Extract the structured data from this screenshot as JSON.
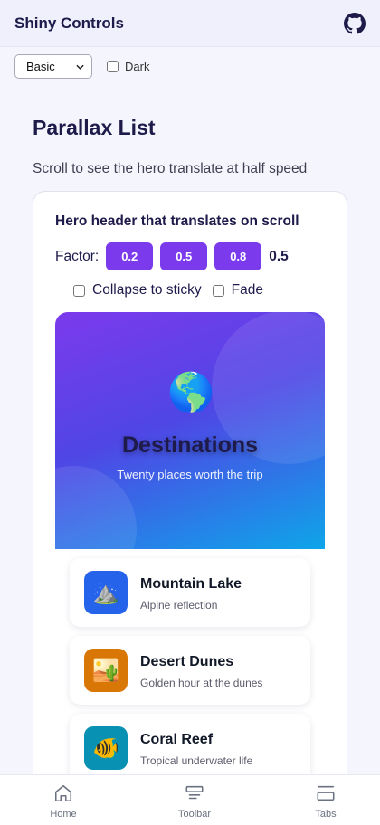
{
  "app": {
    "title": "Shiny Controls"
  },
  "controls": {
    "variant": "Basic",
    "dark_label": "Dark"
  },
  "page": {
    "title": "Parallax List",
    "subtitle": "Scroll to see the hero translate at half speed"
  },
  "card": {
    "title": "Hero header that translates on scroll",
    "factor_label": "Factor:",
    "factors": [
      "0.2",
      "0.5",
      "0.8"
    ],
    "factor_value": "0.5",
    "collapse_label": "Collapse to sticky",
    "fade_label": "Fade"
  },
  "hero": {
    "icon": "🌎",
    "title": "Destinations",
    "subtitle": "Twenty places worth the trip"
  },
  "items": [
    {
      "icon": "⛰️",
      "title": "Mountain Lake",
      "subtitle": "Alpine reflection",
      "color": "#2563eb"
    },
    {
      "icon": "🏜️",
      "title": "Desert Dunes",
      "subtitle": "Golden hour at the dunes",
      "color": "#d97706"
    },
    {
      "icon": "🐠",
      "title": "Coral Reef",
      "subtitle": "Tropical underwater life",
      "color": "#0891b2"
    }
  ],
  "nav": {
    "home": "Home",
    "toolbar": "Toolbar",
    "tabs": "Tabs"
  },
  "colors": {
    "accent": "#7c3aed",
    "hero_start": "#7c3aed",
    "hero_end": "#0ea5e9"
  }
}
